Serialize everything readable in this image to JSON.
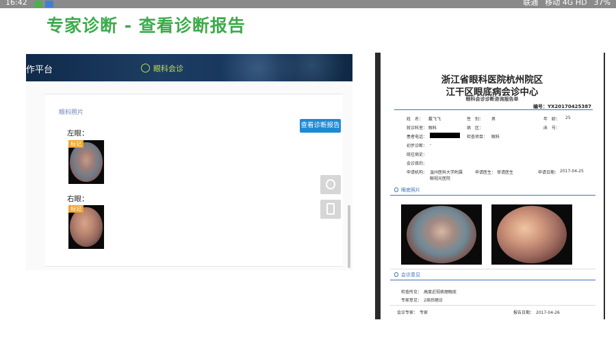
{
  "status_bar": {
    "time": "16:42",
    "right_text": "联通",
    "carrier2": "移动 4G HD",
    "battery": "37%"
  },
  "headline": "专家诊断  -  查看诊断报告",
  "app": {
    "title": "作平台",
    "nav_label": "眼科会诊",
    "section_label": "眼科照片",
    "view_report_button": "查看诊断报告",
    "left_eye_label": "左眼：",
    "right_eye_label": "右眼：",
    "left_badge": "标记",
    "right_badge": "标记"
  },
  "report": {
    "hospital": "浙江省眼科医院杭州院区",
    "center": "江干区眼底病会诊中心",
    "subtitle": "眼科会诊诊断咨询报告单",
    "number": "编号：YX20170425387",
    "fields": {
      "name_label": "姓　名：",
      "name_value": "戴飞飞",
      "gender_label": "性　别：",
      "gender_value": "男",
      "age_label": "年　龄：",
      "age_value": "25",
      "dept_label": "就诊科室：",
      "dept_value": "眼科",
      "ward_label": "病　区：",
      "bed_label": "床　号：",
      "phone_label": "患者电话：",
      "exam_label": "检查项目：",
      "exam_value": "眼科",
      "prelim_label": "初步诊断：",
      "prelim_value": "-",
      "history_label": "既往病史：",
      "purpose_label": "会诊目的：",
      "apply_org_label": "申请机构：",
      "apply_org_value": "温州医科大学附属",
      "apply_org_value2": "眼视光医院",
      "apply_doctor_label": "申请医生：",
      "apply_doctor_value": "审请医生",
      "apply_date_label": "申请日期：",
      "apply_date_value": "2017-04-25"
    },
    "photos_section": "眼底照片",
    "opinion_section": "会诊意见",
    "exam_findings": "检查所见：　高度近视病理眼底",
    "expert_advice": "专家意见：　2周后随访",
    "consult_expert": "会诊专家：　专家",
    "report_date": "报告日期：　2017-04-26"
  }
}
